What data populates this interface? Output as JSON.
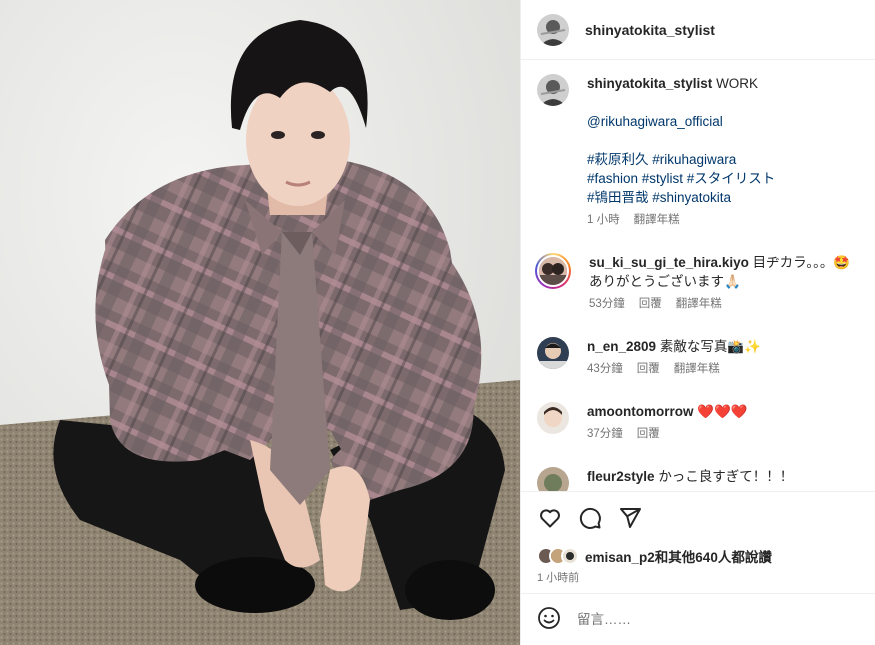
{
  "post": {
    "author": "shinyatokita_stylist",
    "caption": {
      "username": "shinyatokita_stylist",
      "title": "WORK",
      "mention": "@rikuhagiwara_official",
      "hashtags_line1": "#萩原利久 #rikuhagiwara",
      "hashtags_line2": "#fashion #stylist #スタイリスト",
      "hashtags_line3": "#鴇田晋哉 #shinyatokita",
      "time": "1 小時",
      "translate": "翻譯年糕"
    },
    "comments": [
      {
        "username": "su_ki_su_gi_te_hira.kiyo",
        "text": "目ヂカラ。。。🤩 ありがとうございます🙏🏻",
        "time": "53分鐘",
        "reply": "回覆",
        "translate": "翻譯年糕"
      },
      {
        "username": "n_en_2809",
        "text": "素敵な写真📸✨",
        "time": "43分鐘",
        "reply": "回覆",
        "translate": "翻譯年糕"
      },
      {
        "username": "amoontomorrow",
        "text": "❤️❤️❤️",
        "time": "37分鐘",
        "reply": "回覆"
      },
      {
        "username": "fleur2style",
        "text": "かっこ良すぎて！！！"
      }
    ],
    "likes": {
      "user": "emisan_p2",
      "suffix": "和其他640人都說讚"
    },
    "posted_time": "1 小時前",
    "comment_placeholder": "留言……"
  },
  "icons": {
    "like": "heart-icon",
    "comment": "comment-icon",
    "share": "paper-plane-icon",
    "emoji": "smiley-icon"
  },
  "colors": {
    "link": "#00376b",
    "meta": "#737373",
    "border": "#efefef"
  }
}
